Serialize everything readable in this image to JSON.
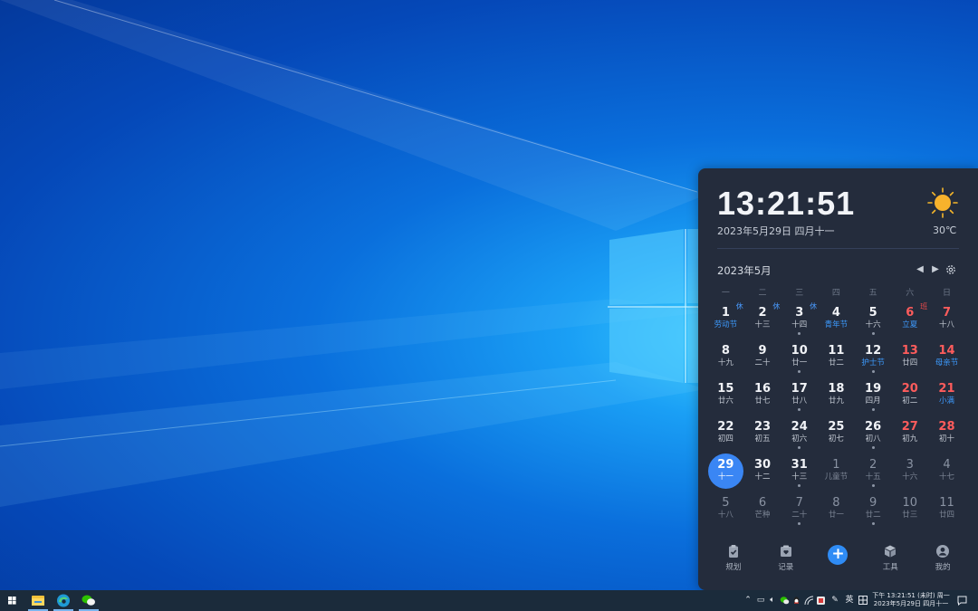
{
  "calendar": {
    "time": "13:21:51",
    "date_line": "2023年5月29日 四月十一",
    "weather": {
      "icon": "sun-icon",
      "temperature": "30℃"
    },
    "month_title": "2023年5月",
    "weekdays": [
      "一",
      "二",
      "三",
      "四",
      "五",
      "六",
      "日"
    ],
    "weeks": [
      [
        {
          "num": "1",
          "sub": "劳动节",
          "tag": "休",
          "dot": false
        },
        {
          "num": "2",
          "sub": "十三",
          "tag": "休",
          "dot": false
        },
        {
          "num": "3",
          "sub": "十四",
          "tag": "休",
          "dot": true
        },
        {
          "num": "4",
          "sub": "青年节",
          "tag": "",
          "dot": false
        },
        {
          "num": "5",
          "sub": "十六",
          "tag": "",
          "dot": true
        },
        {
          "num": "6",
          "sub": "立夏",
          "tag": "班",
          "dot": false
        },
        {
          "num": "7",
          "sub": "十八",
          "tag": "",
          "dot": false
        }
      ],
      [
        {
          "num": "8",
          "sub": "十九",
          "tag": "",
          "dot": false
        },
        {
          "num": "9",
          "sub": "二十",
          "tag": "",
          "dot": false
        },
        {
          "num": "10",
          "sub": "廿一",
          "tag": "",
          "dot": true
        },
        {
          "num": "11",
          "sub": "廿二",
          "tag": "",
          "dot": false
        },
        {
          "num": "12",
          "sub": "护士节",
          "tag": "",
          "dot": true
        },
        {
          "num": "13",
          "sub": "廿四",
          "tag": "",
          "dot": false
        },
        {
          "num": "14",
          "sub": "母亲节",
          "tag": "",
          "dot": false
        }
      ],
      [
        {
          "num": "15",
          "sub": "廿六",
          "tag": "",
          "dot": false
        },
        {
          "num": "16",
          "sub": "廿七",
          "tag": "",
          "dot": false
        },
        {
          "num": "17",
          "sub": "廿八",
          "tag": "",
          "dot": true
        },
        {
          "num": "18",
          "sub": "廿九",
          "tag": "",
          "dot": false
        },
        {
          "num": "19",
          "sub": "四月",
          "tag": "",
          "dot": true
        },
        {
          "num": "20",
          "sub": "初二",
          "tag": "",
          "dot": false
        },
        {
          "num": "21",
          "sub": "小满",
          "tag": "",
          "dot": false
        }
      ],
      [
        {
          "num": "22",
          "sub": "初四",
          "tag": "",
          "dot": false
        },
        {
          "num": "23",
          "sub": "初五",
          "tag": "",
          "dot": false
        },
        {
          "num": "24",
          "sub": "初六",
          "tag": "",
          "dot": true
        },
        {
          "num": "25",
          "sub": "初七",
          "tag": "",
          "dot": false
        },
        {
          "num": "26",
          "sub": "初八",
          "tag": "",
          "dot": true
        },
        {
          "num": "27",
          "sub": "初九",
          "tag": "",
          "dot": false
        },
        {
          "num": "28",
          "sub": "初十",
          "tag": "",
          "dot": false
        }
      ],
      [
        {
          "num": "29",
          "sub": "十一",
          "tag": "",
          "dot": false
        },
        {
          "num": "30",
          "sub": "十二",
          "tag": "",
          "dot": false
        },
        {
          "num": "31",
          "sub": "十三",
          "tag": "",
          "dot": true
        },
        {
          "num": "1",
          "sub": "儿童节",
          "tag": "",
          "dot": false
        },
        {
          "num": "2",
          "sub": "十五",
          "tag": "",
          "dot": true
        },
        {
          "num": "3",
          "sub": "十六",
          "tag": "",
          "dot": false
        },
        {
          "num": "4",
          "sub": "十七",
          "tag": "",
          "dot": false
        }
      ],
      [
        {
          "num": "5",
          "sub": "十八",
          "tag": "",
          "dot": false
        },
        {
          "num": "6",
          "sub": "芒种",
          "tag": "",
          "dot": false
        },
        {
          "num": "7",
          "sub": "二十",
          "tag": "",
          "dot": true
        },
        {
          "num": "8",
          "sub": "廿一",
          "tag": "",
          "dot": false
        },
        {
          "num": "9",
          "sub": "廿二",
          "tag": "",
          "dot": true
        },
        {
          "num": "10",
          "sub": "廿三",
          "tag": "",
          "dot": false
        },
        {
          "num": "11",
          "sub": "廿四",
          "tag": "",
          "dot": false
        }
      ]
    ],
    "bottom_tabs": [
      {
        "label": "规划",
        "icon": "clipboard-check-icon"
      },
      {
        "label": "记录",
        "icon": "notebook-heart-icon"
      },
      {
        "label": "",
        "icon": "plus-icon"
      },
      {
        "label": "工具",
        "icon": "cube-icon"
      },
      {
        "label": "我的",
        "icon": "user-icon"
      }
    ]
  },
  "taskbar": {
    "apps": [
      {
        "name": "start-icon"
      },
      {
        "name": "file-explorer-icon"
      },
      {
        "name": "edge-browser-icon"
      },
      {
        "name": "wechat-icon"
      }
    ],
    "tray": {
      "ime_label": "英",
      "clock_line1": "下午 13:21:51 (未时) 周一",
      "clock_line2": "2023年5月29日 四月十一"
    }
  }
}
